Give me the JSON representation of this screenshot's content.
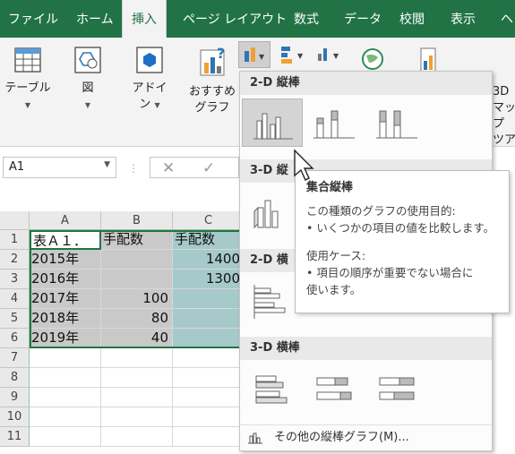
{
  "tabs": [
    {
      "label": "ファイル",
      "active": false
    },
    {
      "label": "ホーム",
      "active": false
    },
    {
      "label": "挿入",
      "active": true
    },
    {
      "label": "ページ レイアウト",
      "active": false
    },
    {
      "label": "数式",
      "active": false
    },
    {
      "label": "データ",
      "active": false
    },
    {
      "label": "校閲",
      "active": false
    },
    {
      "label": "表示",
      "active": false
    },
    {
      "label": "ヘ",
      "active": false
    }
  ],
  "ribbon": {
    "table": "テーブル",
    "figure": "図",
    "addin_1": "アドイ",
    "addin_2": "ン",
    "recommended_1": "おすすめ",
    "recommended_2": "グラフ",
    "map_1": "3D",
    "map_2": "マップ",
    "tour": "ツアー"
  },
  "formula_bar": {
    "name_box": "A1",
    "cancel_symbol": "✕",
    "enter_symbol": "✓"
  },
  "sheet": {
    "columns": [
      "A",
      "B",
      "C"
    ],
    "rows": [
      "1",
      "2",
      "3",
      "4",
      "5",
      "6",
      "7",
      "8",
      "9",
      "10",
      "11"
    ],
    "cells": {
      "a1": "表Ａ１．",
      "b1": "手配数",
      "c1": "手配数",
      "a2": "2015年",
      "b2": "",
      "c2": "1400",
      "a3": "2016年",
      "b3": "",
      "c3": "1300",
      "a4": "2017年",
      "b4": "100",
      "c4": "",
      "a5": "2018年",
      "b5": "80",
      "c5": "",
      "a6": "2019年",
      "b6": "40",
      "c6": ""
    }
  },
  "gallery": {
    "section_2d_column": "2-D 縦棒",
    "section_3d_column": "3-D 縦",
    "section_2d_bar": "2-D 横",
    "section_3d_bar": "3-D 横棒",
    "more_charts": "その他の縦棒グラフ(M)..."
  },
  "tooltip": {
    "title": "集合縦棒",
    "purpose_heading": "この種類のグラフの使用目的:",
    "purpose_item": "• いくつかの項目の値を比較します。",
    "usecase_heading": "使用ケース:",
    "usecase_item_1": "• 項目の順序が重要でない場合に",
    "usecase_item_2": "使います。"
  },
  "colors": {
    "ribbon_green": "#217346",
    "selection_gray": "#c9c9c9",
    "selection_teal": "#a6c9ca"
  }
}
